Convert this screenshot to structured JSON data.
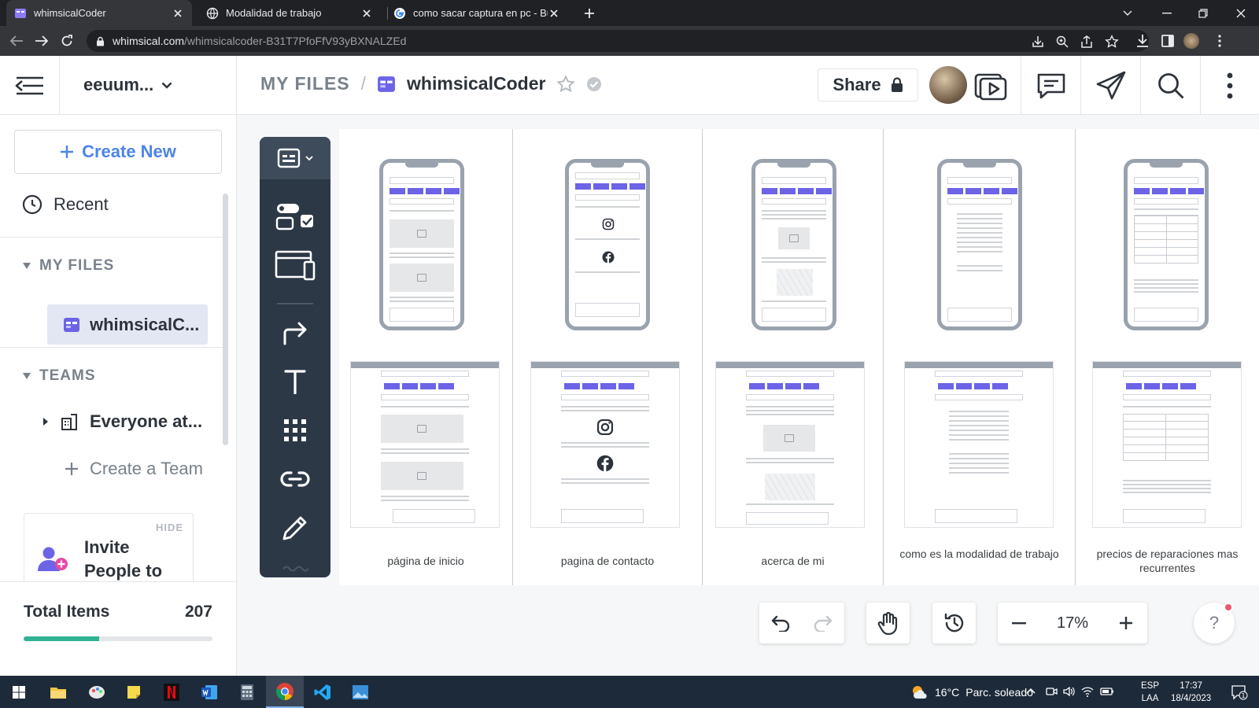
{
  "browser": {
    "tabs": [
      {
        "title": "whimsicalCoder",
        "active": true
      },
      {
        "title": "Modalidad de trabajo",
        "active": false
      },
      {
        "title": "como sacar captura en pc - Busc",
        "active": false
      }
    ],
    "url_host": "whimsical.com",
    "url_path": "/whimsicalcoder-B31T7PfoFfV93yBXNALZEd"
  },
  "sidebar": {
    "workspace": "eeuum...",
    "create_new": "Create New",
    "recent": "Recent",
    "my_files": "MY FILES",
    "file_item": "whimsicalC...",
    "teams": "TEAMS",
    "team_item": "Everyone at...",
    "create_team": "Create a Team",
    "invite_hide": "HIDE",
    "invite_text": "Invite People to",
    "total_items_label": "Total Items",
    "total_items_value": "207",
    "progress_fraction": 0.4
  },
  "header": {
    "breadcrumb_root": "MY FILES",
    "breadcrumb_sep": "/",
    "file_name": "whimsicalCoder",
    "share_label": "Share"
  },
  "board": {
    "columns": [
      {
        "caption": "página de inicio"
      },
      {
        "caption": "pagina de contacto"
      },
      {
        "caption": "acerca de mi"
      },
      {
        "caption": "como es la modalidad de trabajo"
      },
      {
        "caption": "precios de reparaciones mas recurrentes"
      }
    ]
  },
  "controls": {
    "zoom": "17%",
    "help": "?"
  },
  "taskbar": {
    "weather_temp": "16°C",
    "weather_text": "Parc. soleado",
    "lang_1": "ESP",
    "lang_2": "LAA",
    "time": "17:37",
    "date": "18/4/2023",
    "notifications": "1"
  }
}
